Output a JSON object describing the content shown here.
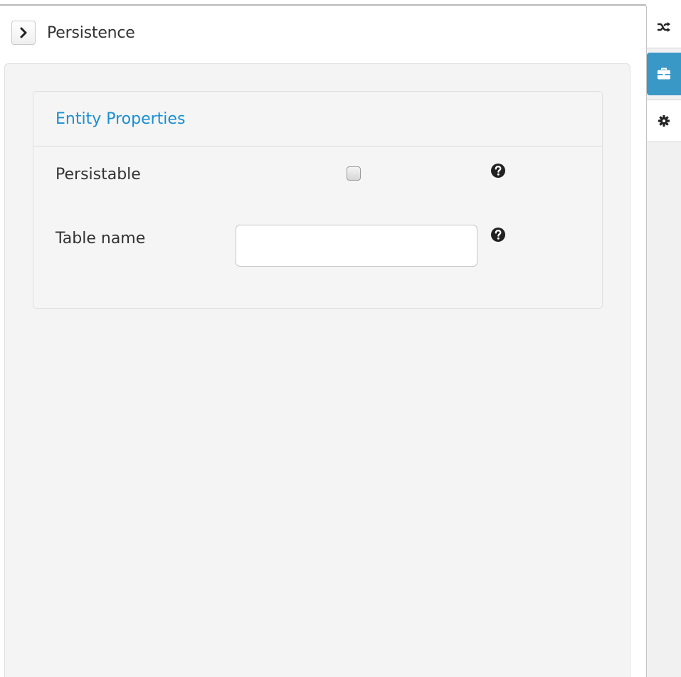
{
  "header": {
    "title": "Persistence",
    "collapse_icon": "chevron-right-icon"
  },
  "card": {
    "title": "Entity Properties",
    "fields": {
      "persistable": {
        "label": "Persistable",
        "checked": false,
        "help_icon": "question-circle-icon"
      },
      "table_name": {
        "label": "Table name",
        "value": "",
        "placeholder": "",
        "help_icon": "question-circle-icon"
      }
    }
  },
  "right_rail": {
    "items": [
      {
        "icon": "shuffle-icon",
        "active": false
      },
      {
        "icon": "briefcase-icon",
        "active": true
      },
      {
        "icon": "gear-icon",
        "active": false
      }
    ]
  },
  "colors": {
    "accent": "#1a8fd1",
    "active_rail": "#3a98c7",
    "panel_bg": "#f4f4f4"
  }
}
